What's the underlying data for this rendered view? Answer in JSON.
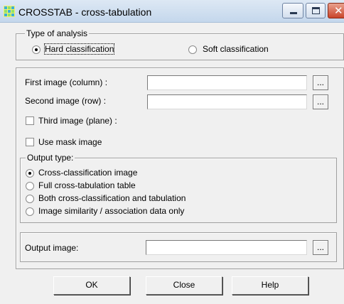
{
  "window": {
    "title": "CROSSTAB - cross-tabulation",
    "app_icon": "grid-icon",
    "controls": [
      "minimize-icon",
      "maximize-icon",
      "close-icon"
    ]
  },
  "analysis_type": {
    "group_label": "Type of analysis",
    "options": [
      {
        "label": "Hard classification",
        "selected": true
      },
      {
        "label": "Soft classification",
        "selected": false
      }
    ]
  },
  "inputs": {
    "first_image_label": "First image (column) :",
    "first_image_value": "",
    "second_image_label": "Second image (row) :",
    "second_image_value": "",
    "browse_label": "...",
    "third_image_label": "Third image (plane) :",
    "third_image_checked": false,
    "mask_label": "Use mask image",
    "mask_checked": false
  },
  "output_type": {
    "group_label": "Output type:",
    "options": [
      {
        "label": "Cross-classification image",
        "selected": true
      },
      {
        "label": "Full cross-tabulation table",
        "selected": false
      },
      {
        "label": "Both cross-classification and tabulation",
        "selected": false
      },
      {
        "label": "Image similarity / association data only",
        "selected": false
      }
    ]
  },
  "output": {
    "label": "Output image:",
    "value": "",
    "browse_label": "..."
  },
  "buttons": {
    "ok": "OK",
    "close": "Close",
    "help": "Help"
  },
  "colors": {
    "dialog_bg": "#f0f0f0",
    "title_bar": "#c4d7ec",
    "close_button": "#c9452b"
  }
}
